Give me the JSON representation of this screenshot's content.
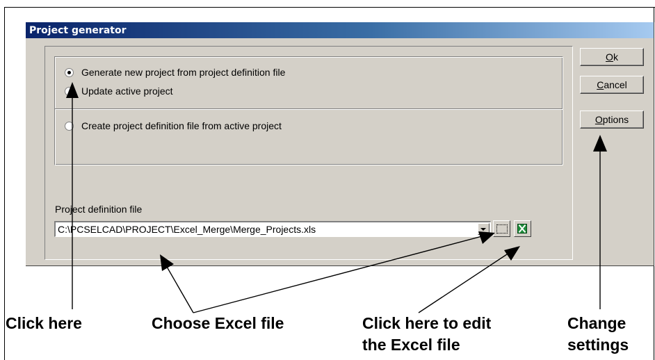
{
  "dialog": {
    "title": "Project generator",
    "options": [
      {
        "label": "Generate new project from project definition file",
        "selected": true
      },
      {
        "label": "Update active project",
        "selected": false
      },
      {
        "label": "Create project definition file from active project",
        "selected": false
      }
    ],
    "file_label": "Project definition file",
    "file_value": "C:\\PCSELCAD\\PROJECT\\Excel_Merge\\Merge_Projects.xls",
    "buttons": {
      "ok": {
        "accel": "O",
        "rest": "k"
      },
      "cancel": {
        "accel": "C",
        "rest": "ancel"
      },
      "options": {
        "accel": "O",
        "rest": "ptions"
      }
    }
  },
  "annotations": {
    "click_here": "Click here",
    "choose_excel": "Choose Excel file",
    "edit_excel_line1": "Click here to edit",
    "edit_excel_line2": "the Excel file",
    "change_line1": "Change",
    "change_line2": "settings"
  }
}
